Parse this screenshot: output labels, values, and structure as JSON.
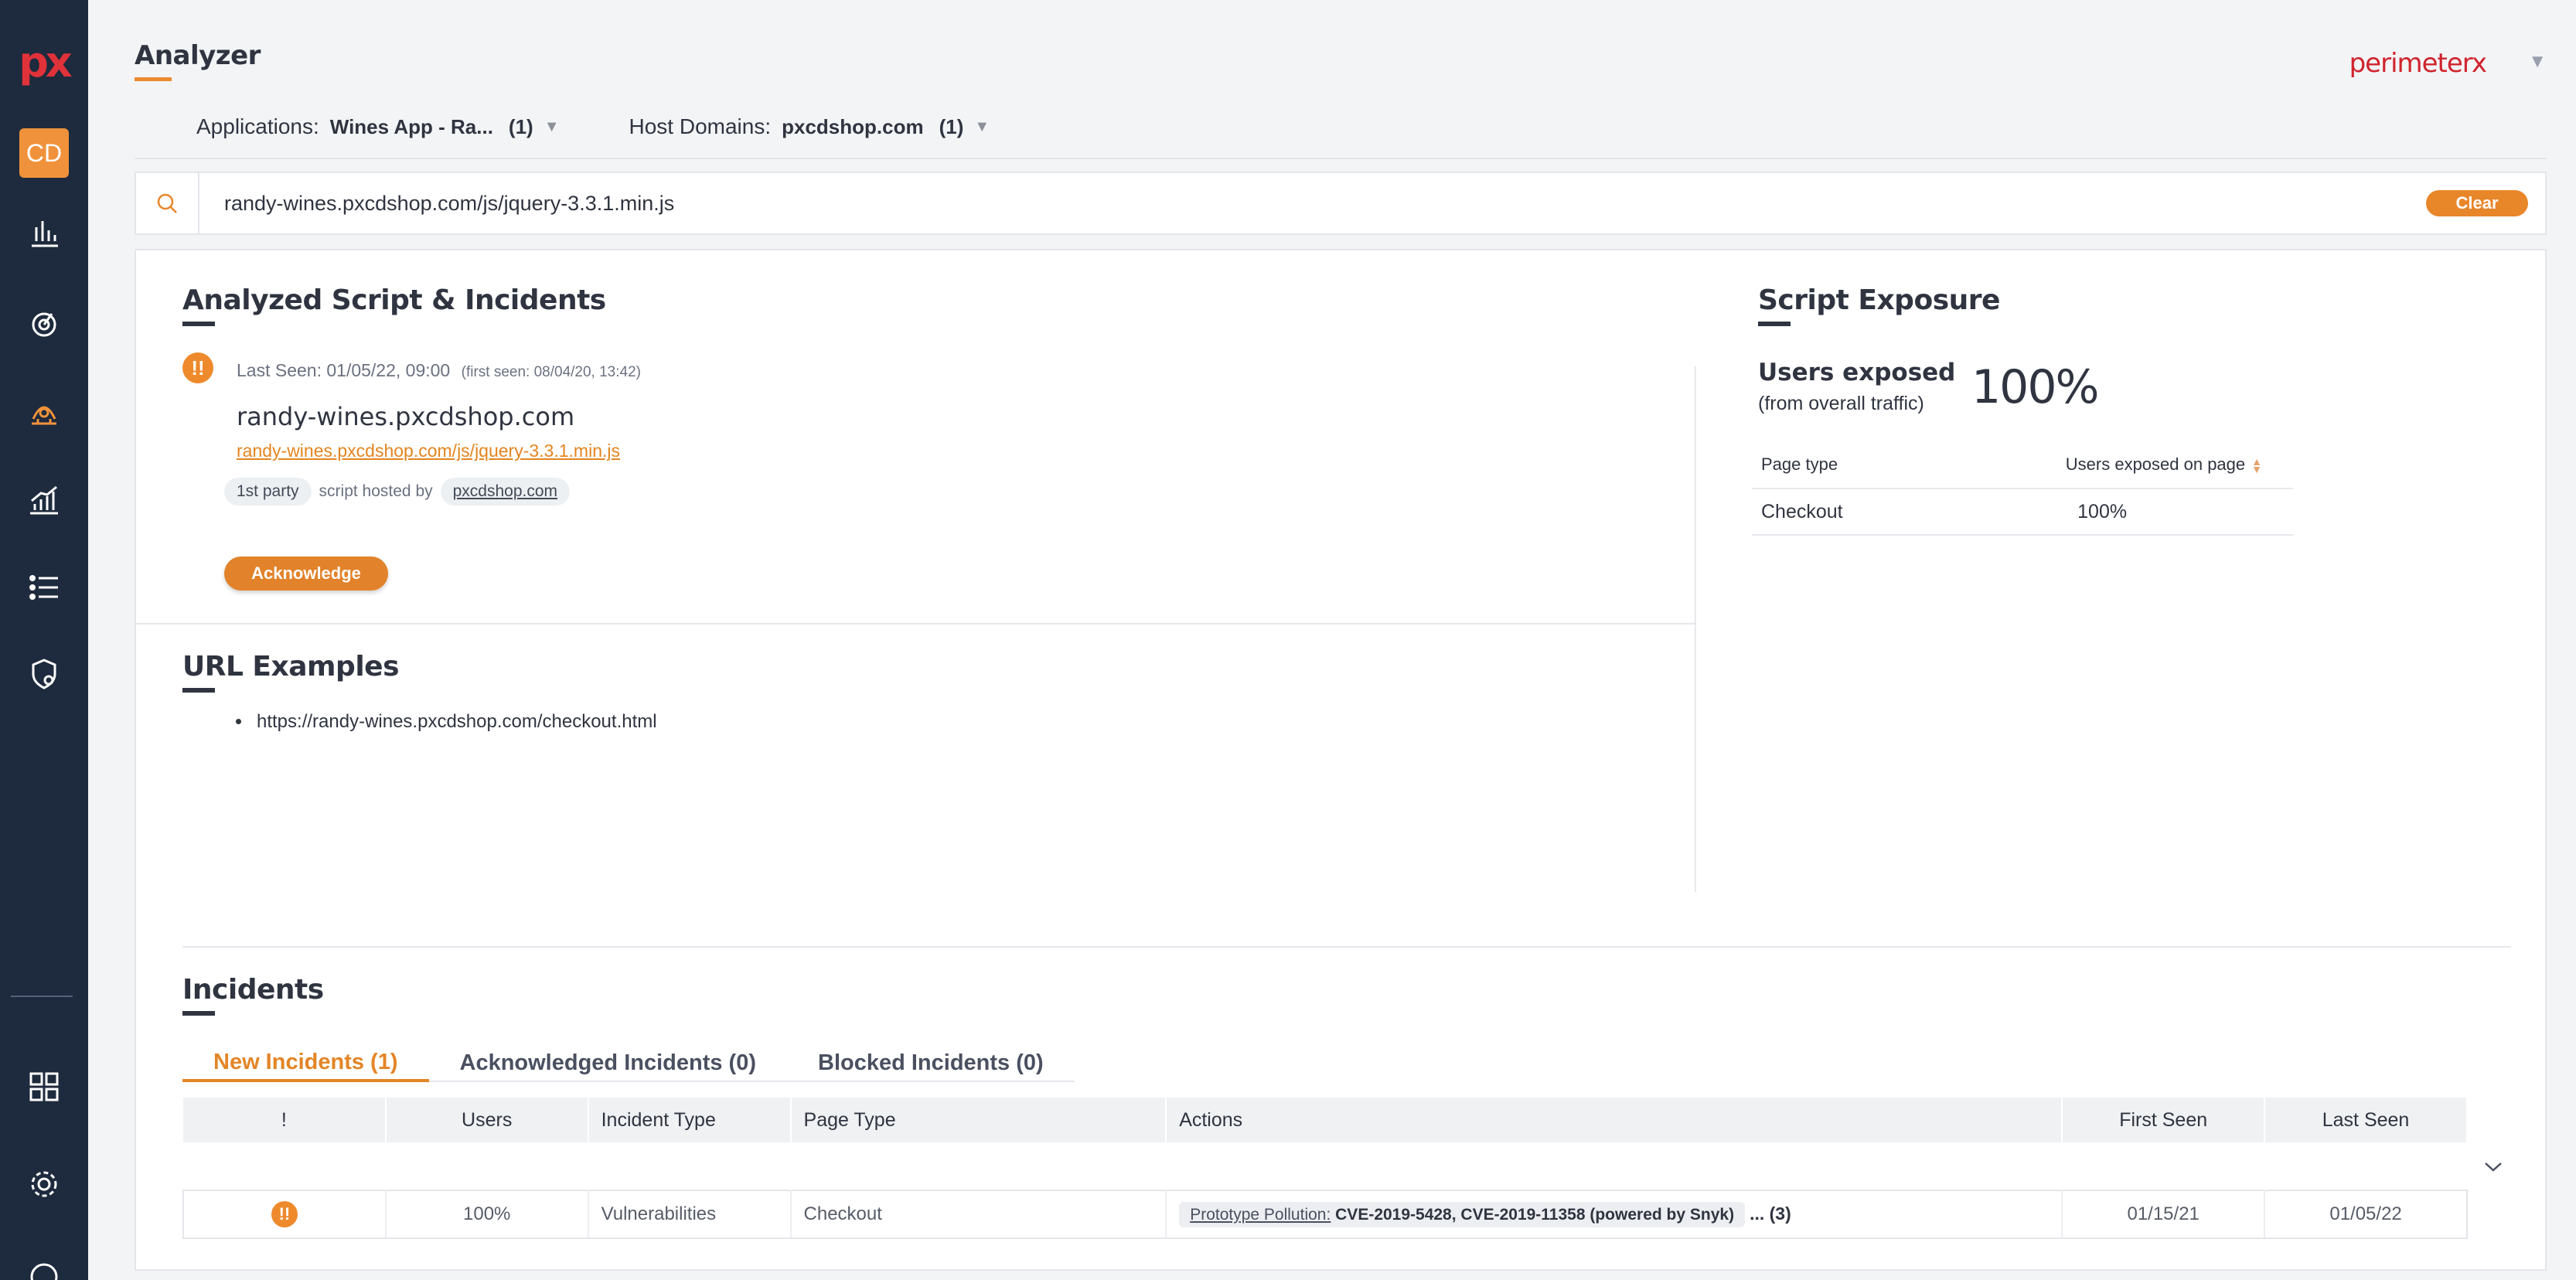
{
  "sidebar": {
    "logo": "px",
    "avatar_initials": "CD",
    "icons": [
      "bar-chart-icon",
      "radar-icon",
      "analyzer-icon",
      "trend-chart-icon",
      "list-icon",
      "shield-gear-icon",
      "apps-grid-icon",
      "settings-gear-icon",
      "help-icon"
    ]
  },
  "header": {
    "title": "Analyzer",
    "brand": "perimeterx"
  },
  "filters": {
    "applications_label": "Applications:",
    "applications_value": "Wines App - Ra...",
    "applications_count": "(1)",
    "hosts_label": "Host Domains:",
    "hosts_value": "pxcdshop.com",
    "hosts_count": "(1)"
  },
  "search": {
    "value": "randy-wines.pxcdshop.com/js/jquery-3.3.1.min.js",
    "clear_label": "Clear"
  },
  "analyzed": {
    "title": "Analyzed Script & Incidents",
    "last_seen": "Last Seen: 01/05/22, 09:00",
    "first_seen": "(first seen: 08/04/20, 13:42)",
    "host": "randy-wines.pxcdshop.com",
    "script_url": "randy-wines.pxcdshop.com/js/jquery-3.3.1.min.js",
    "party_tag": "1st party",
    "hosted_by_text": "script hosted by",
    "hosted_by_domain": "pxcdshop.com",
    "acknowledge_label": "Acknowledge"
  },
  "url_examples": {
    "title": "URL Examples",
    "items": [
      "https://randy-wines.pxcdshop.com/checkout.html"
    ]
  },
  "exposure": {
    "title": "Script Exposure",
    "users_exposed_label": "Users exposed",
    "users_exposed_sub": "(from overall traffic)",
    "users_exposed_value": "100%",
    "table_headers": [
      "Page type",
      "Users exposed on page"
    ],
    "rows": [
      {
        "page_type": "Checkout",
        "value": "100%"
      }
    ]
  },
  "incidents": {
    "title": "Incidents",
    "tabs": [
      "New Incidents (1)",
      "Acknowledged Incidents (0)",
      "Blocked Incidents (0)"
    ],
    "headers": [
      "!",
      "Users",
      "Incident Type",
      "Page Type",
      "Actions",
      "First Seen",
      "Last Seen"
    ],
    "rows": [
      {
        "users": "100%",
        "incident_type": "Vulnerabilities",
        "page_type": "Checkout",
        "action_link": "Prototype Pollution:",
        "action_detail": "CVE-2019-5428, CVE-2019-11358 (powered by Snyk)",
        "action_more": "... (3)",
        "first_seen": "01/15/21",
        "last_seen": "01/05/22"
      }
    ]
  },
  "colors": {
    "sidebar_bg": "#1e2a3d",
    "accent": "#e8862a",
    "brand_red": "#d0232c"
  }
}
